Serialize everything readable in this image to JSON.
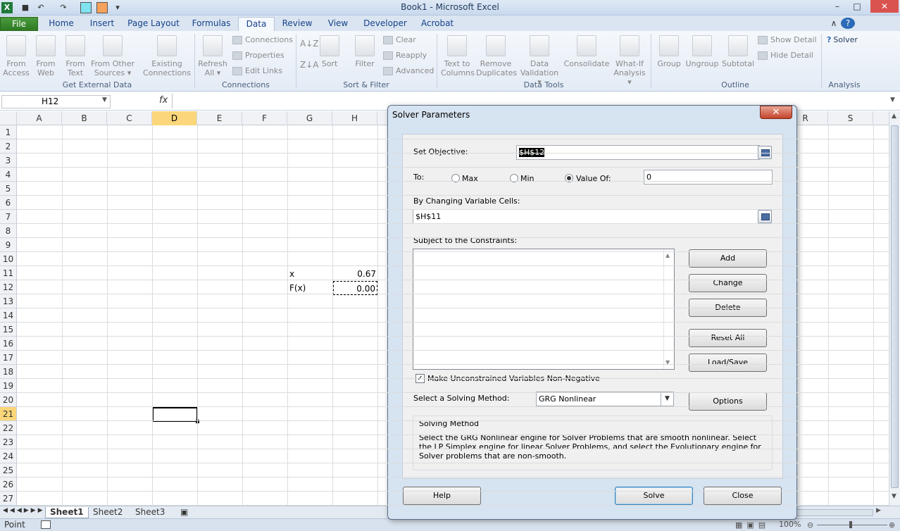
{
  "window": {
    "title": "Book1 - Microsoft Excel",
    "controls": {
      "minimize": "–",
      "restore": "□",
      "close": "✕"
    }
  },
  "qat": {
    "undo": "↶",
    "redo": "↷",
    "dropdown": "▾"
  },
  "tabs": [
    "File",
    "Home",
    "Insert",
    "Page Layout",
    "Formulas",
    "Data",
    "Review",
    "View",
    "Developer",
    "Acrobat"
  ],
  "active_tab": "Data",
  "ribbon": {
    "get_external": {
      "from_access": [
        "From",
        "Access"
      ],
      "from_web": [
        "From",
        "Web"
      ],
      "from_text": [
        "From",
        "Text"
      ],
      "from_other": [
        "From Other",
        "Sources ▾"
      ],
      "existing": [
        "Existing",
        "Connections"
      ],
      "group_label": "Get External Data"
    },
    "connections": {
      "refresh": [
        "Refresh",
        "All ▾"
      ],
      "connections": "Connections",
      "properties": "Properties",
      "edit_links": "Edit Links",
      "group_label": "Connections"
    },
    "sort_filter": {
      "sort": "Sort",
      "filter": "Filter",
      "clear": "Clear",
      "reapply": "Reapply",
      "advanced": "Advanced",
      "group_label": "Sort & Filter"
    },
    "data_tools": {
      "text_to_columns": [
        "Text to",
        "Columns"
      ],
      "remove_duplicates": [
        "Remove",
        "Duplicates"
      ],
      "data_validation": [
        "Data",
        "Validation ▾"
      ],
      "consolidate": "Consolidate",
      "what_if": [
        "What-If",
        "Analysis ▾"
      ],
      "group_label": "Data Tools"
    },
    "outline": {
      "group": "Group",
      "ungroup": "Ungroup",
      "subtotal": "Subtotal",
      "show_detail": "Show Detail",
      "hide_detail": "Hide Detail",
      "group_label": "Outline"
    },
    "analysis": {
      "solver": "Solver",
      "group_label": "Analysis"
    }
  },
  "formula_bar": {
    "name_box": "H12",
    "fx": "fx",
    "value": ""
  },
  "columns": [
    "A",
    "B",
    "C",
    "D",
    "E",
    "F",
    "G",
    "H",
    "R",
    "S"
  ],
  "selected_column": "D",
  "rows": [
    "1",
    "2",
    "3",
    "4",
    "5",
    "6",
    "7",
    "8",
    "9",
    "10",
    "11",
    "12",
    "13",
    "14",
    "15",
    "16",
    "17",
    "18",
    "19",
    "20",
    "21",
    "22",
    "23",
    "24",
    "25",
    "26",
    "27"
  ],
  "selected_row": "21",
  "cells": {
    "G11": "x",
    "H11": "0.67",
    "G12": "F(x)",
    "H12": "0.00"
  },
  "sheet_tabs": [
    "Sheet1",
    "Sheet2",
    "Sheet3"
  ],
  "active_sheet": "Sheet1",
  "status": {
    "mode": "Point",
    "zoom": "100%"
  },
  "solver": {
    "title": "Solver Parameters",
    "set_objective_label": "Set Objective:",
    "set_objective_value": "$H$12",
    "to_label": "To:",
    "options": [
      {
        "label": "Max",
        "selected": false
      },
      {
        "label": "Min",
        "selected": false
      },
      {
        "label": "Value Of:",
        "selected": true
      }
    ],
    "value_of": "0",
    "changing_label": "By Changing Variable Cells:",
    "changing_value": "$H$11",
    "constraints_label": "Subject to the Constraints:",
    "buttons": {
      "add": "Add",
      "change": "Change",
      "delete": "Delete",
      "reset_all": "Reset All",
      "load_save": "Load/Save",
      "options": "Options",
      "help": "Help",
      "solve": "Solve",
      "close": "Close"
    },
    "non_negative_label": "Make Unconstrained Variables Non-Negative",
    "non_negative_checked": true,
    "method_label": "Select a Solving Method:",
    "method_value": "GRG Nonlinear",
    "method_group_title": "Solving Method",
    "method_description": "Select the GRG Nonlinear engine for Solver Problems that are smooth nonlinear. Select the LP Simplex engine for linear Solver Problems, and select the Evolutionary engine for Solver problems that are non-smooth."
  }
}
